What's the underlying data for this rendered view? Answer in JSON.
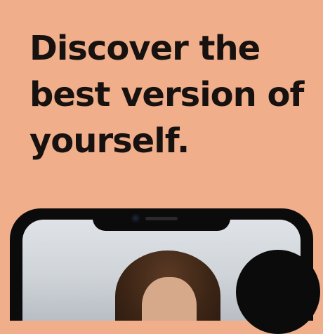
{
  "hero": {
    "headline_line1": "Discover the",
    "headline_line2": "best version of",
    "headline_line3": "yourself."
  },
  "colors": {
    "background": "#F0AE8A",
    "text": "#17120f",
    "phone_frame": "#0c0b0b"
  },
  "icons": {
    "camera": "camera-icon",
    "speaker": "speaker-icon"
  }
}
